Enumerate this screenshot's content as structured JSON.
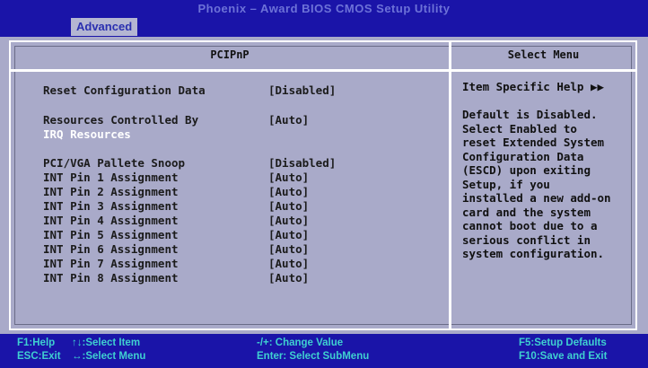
{
  "header": {
    "title": "Phoenix – Award BIOS CMOS Setup Utility",
    "tab": "Advanced"
  },
  "main": {
    "title": "PCIPnP",
    "items": [
      {
        "label": "Reset Configuration Data",
        "value": "[Disabled]"
      },
      {
        "label": "Resources Controlled By",
        "value": "[Auto]"
      },
      {
        "label": "IRQ Resources",
        "value": ""
      },
      {
        "label": "PCI/VGA Pallete Snoop",
        "value": "[Disabled]"
      },
      {
        "label": "INT Pin 1 Assignment",
        "value": "[Auto]"
      },
      {
        "label": "INT Pin 2 Assignment",
        "value": "[Auto]"
      },
      {
        "label": "INT Pin 3 Assignment",
        "value": "[Auto]"
      },
      {
        "label": "INT Pin 4 Assignment",
        "value": "[Auto]"
      },
      {
        "label": "INT Pin 5 Assignment",
        "value": "[Auto]"
      },
      {
        "label": "INT Pin 6 Assignment",
        "value": "[Auto]"
      },
      {
        "label": "INT Pin 7 Assignment",
        "value": "[Auto]"
      },
      {
        "label": "INT Pin 8 Assignment",
        "value": "[Auto]"
      }
    ]
  },
  "help": {
    "title": "Select Menu",
    "heading": "Item Specific Help ▶▶",
    "lines": [
      "Default is Disabled.",
      "Select Enabled to",
      "reset Extended System",
      "Configuration Data",
      "(ESCD) upon exiting",
      "Setup, if you",
      "installed a new add-on",
      "card and the system",
      "cannot boot due to a",
      "serious conflict in",
      "system configuration."
    ]
  },
  "footer": {
    "f1": "F1:Help",
    "esc": "ESC:Exit",
    "item": "↑↓:Select Item",
    "menu": "↔:Select Menu",
    "change": "-/+: Change Value",
    "enter": "Enter: Select SubMenu",
    "f5": "F5:Setup Defaults",
    "f10": "F10:Save and Exit"
  },
  "colors": {
    "bar": "#1a14a8",
    "panel": "#a9aac9",
    "key_text": "#3fd0d0",
    "selected_text": "#ffffff"
  }
}
